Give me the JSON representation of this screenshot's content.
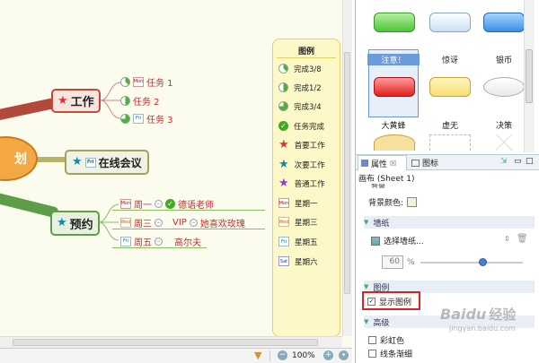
{
  "canvas": {
    "central": {
      "label": "划"
    },
    "topics": [
      {
        "label": "工作",
        "subtopics": [
          "任务 1",
          "任务 2",
          "任务 3"
        ]
      },
      {
        "label": "在线会议",
        "tag": "Fri"
      },
      {
        "label": "预约",
        "subtopics": [
          "周一",
          "周三",
          "周五"
        ],
        "details": [
          "德语老师",
          "VIP",
          "她喜欢玫瑰",
          "高尔夫"
        ]
      }
    ],
    "tags": {
      "mon": "Mon",
      "wed": "Wed",
      "fri": "Fri",
      "sat": "Sat"
    }
  },
  "legend": {
    "title": "图例",
    "items": [
      "完成3/8",
      "完成1/2",
      "完成3/4",
      "任务完成",
      "首要工作",
      "次要工作",
      "普通工作",
      "星期一",
      "星期三",
      "星期五",
      "星期六"
    ]
  },
  "status": {
    "zoom": "100%"
  },
  "styles": {
    "items": [
      "注意！",
      "惊讶",
      "银币",
      "大黄蜂",
      "虚无",
      "决策"
    ]
  },
  "properties": {
    "tabs": [
      "属性",
      "图标"
    ],
    "tab_close": "☒",
    "title": "画布 (Sheet 1)",
    "partial_heading": "背景",
    "bg_color_label": "背景颜色:",
    "wallpaper_section": "墙纸",
    "wallpaper_select": "选择墙纸...",
    "opacity": "60",
    "opacity_unit": "%",
    "legend_section": "图例",
    "show_legend": "显示图例",
    "advanced_section": "高级",
    "rainbow": "彩虹色",
    "tapered": "线条渐细"
  },
  "watermark": {
    "brand": "Baidu",
    "jingyan": "经验",
    "url": "jingyan.baidu.com"
  },
  "colors": {
    "work": "#c9463a",
    "meeting": "#a7a25a",
    "appt": "#5f9e4a",
    "highlight": "#e02020"
  }
}
